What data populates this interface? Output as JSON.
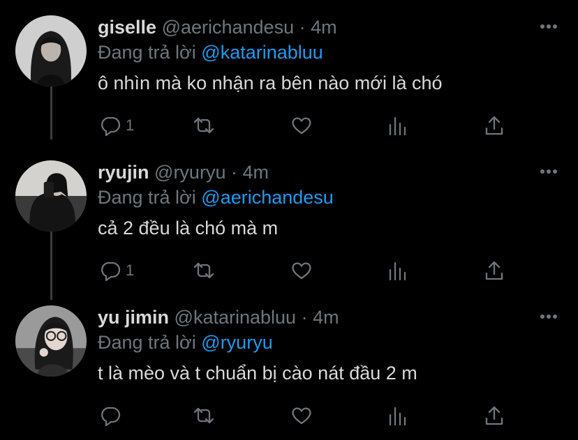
{
  "tweets": [
    {
      "name": "giselle",
      "handle": "@aerichandesu",
      "separator": "·",
      "time": "4m",
      "reply_prefix": "Đang trả lời",
      "reply_to": "@katarinabluu",
      "text": "ô nhìn mà ko nhận ra bên nào mới là chó",
      "reply_count": "1"
    },
    {
      "name": "ryujin",
      "handle": "@ryuryu",
      "separator": "·",
      "time": "4m",
      "reply_prefix": "Đang trả lời",
      "reply_to": "@aerichandesu",
      "text": "cả 2 đều là chó mà m",
      "reply_count": "1"
    },
    {
      "name": "yu jimin",
      "handle": "@katarinabluu",
      "separator": "·",
      "time": "4m",
      "reply_prefix": "Đang trả lời",
      "reply_to": "@ryuryu",
      "text": "t là mèo và t chuẩn bị cào nát đầu 2 m",
      "reply_count": ""
    }
  ],
  "icons": [
    "more-icon",
    "reply-icon",
    "retweet-icon",
    "like-icon",
    "analytics-icon",
    "share-icon"
  ],
  "colors": {
    "background": "#000000",
    "text": "#d9d9d9",
    "muted": "#6e767d",
    "link": "#1d9bf0"
  }
}
